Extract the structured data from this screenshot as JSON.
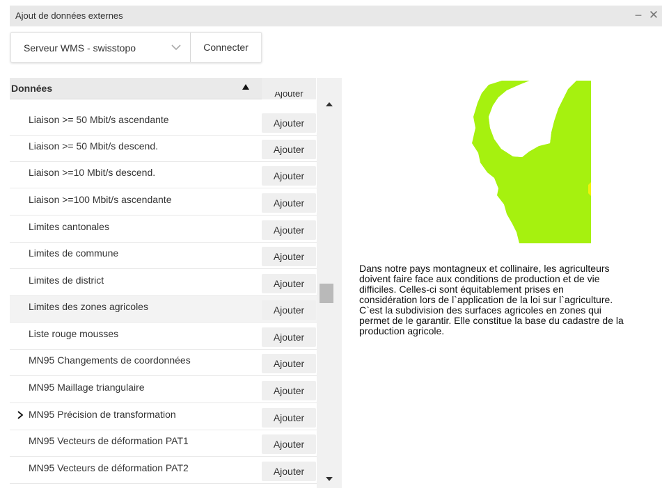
{
  "window": {
    "title": "Ajout de données externes",
    "minimize_glyph": "−",
    "close_glyph": "✕"
  },
  "toolbar": {
    "server_select_value": "Serveur WMS - swisstopo",
    "connect_label": "Connecter"
  },
  "list": {
    "header_label": "Données",
    "partial_top_button": "Ajouter",
    "add_label": "Ajouter",
    "items": [
      {
        "label": "Liaison >= 50 Mbit/s ascendante",
        "highlighted": false,
        "expand_arrow": false
      },
      {
        "label": "Liaison >= 50 Mbit/s descend.",
        "highlighted": false,
        "expand_arrow": false
      },
      {
        "label": "Liaison >=10 Mbit/s descend.",
        "highlighted": false,
        "expand_arrow": false
      },
      {
        "label": "Liaison >=100 Mbit/s ascendante",
        "highlighted": false,
        "expand_arrow": false
      },
      {
        "label": "Limites cantonales",
        "highlighted": false,
        "expand_arrow": false
      },
      {
        "label": "Limites de commune",
        "highlighted": false,
        "expand_arrow": false
      },
      {
        "label": "Limites de district",
        "highlighted": false,
        "expand_arrow": false
      },
      {
        "label": "Limites des zones agricoles",
        "highlighted": true,
        "expand_arrow": false
      },
      {
        "label": "Liste rouge mousses",
        "highlighted": false,
        "expand_arrow": false
      },
      {
        "label": "MN95 Changements de coordonnées",
        "highlighted": false,
        "expand_arrow": false
      },
      {
        "label": "MN95 Maillage triangulaire",
        "highlighted": false,
        "expand_arrow": false
      },
      {
        "label": "MN95 Précision de transformation",
        "highlighted": false,
        "expand_arrow": true
      },
      {
        "label": "MN95 Vecteurs de déformation PAT1",
        "highlighted": false,
        "expand_arrow": false
      },
      {
        "label": "MN95 Vecteurs de déformation PAT2",
        "highlighted": false,
        "expand_arrow": false
      },
      {
        "label": "",
        "highlighted": false,
        "expand_arrow": false
      }
    ]
  },
  "preview": {
    "colors": {
      "agricultural_zone": "#a6f10f",
      "background": "#ffffff",
      "accent": "#f2f20a"
    }
  },
  "description": "Dans notre pays montagneux et collinaire, les agriculteurs doivent faire face aux conditions de production et de vie difficiles. Celles-ci sont équitablement prises en considération lors de l`application de la loi sur l`agriculture. C`est la subdivision des surfaces agricoles en zones qui permet de le garantir. Elle constitue la base du cadastre de la production agricole."
}
